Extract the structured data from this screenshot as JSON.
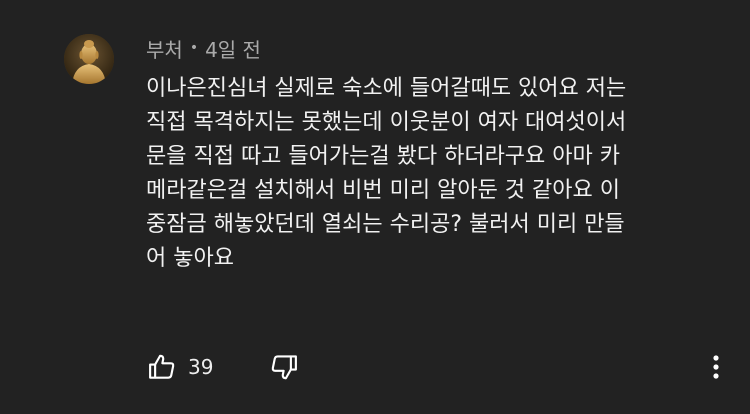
{
  "comment": {
    "author": "부처",
    "separator": "•",
    "time": "4일 전",
    "lines": [
      "이나은진심녀 실제로 숙소에 들어갈때도 있어요 저는",
      "직접 목격하지는 못했는데 이웃분이 여자 대여섯이서",
      "문을 직접 따고 들어가는걸 봤다 하더라구요 아마 카",
      "메라같은걸 설치해서 비번 미리 알아둔 것 같아요 이",
      "중잠금 해놓았던데 열쇠는 수리공? 불러서 미리 만들",
      "어 놓아요"
    ],
    "like_count": "39"
  },
  "icons": {
    "like": "thumbs-up-icon",
    "dislike": "thumbs-down-icon",
    "more": "more-vertical-icon"
  }
}
